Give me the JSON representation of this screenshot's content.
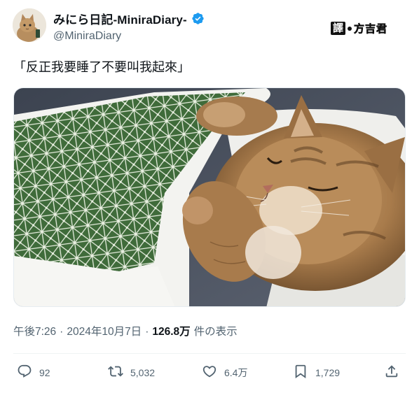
{
  "author": {
    "display_name": "みにら日記-MiniraDiary-",
    "handle": "@MiniraDiary",
    "verified_icon": "verified-badge-icon"
  },
  "watermark": {
    "box_text": "譯",
    "text": "方吉君"
  },
  "tweet": {
    "text": "「反正我要睡了不要叫我起來」"
  },
  "meta": {
    "time": "午後7:26",
    "separator1": "·",
    "date": "2024年10月7日",
    "separator2": "·",
    "views": "126.8万",
    "views_label": "件の表示"
  },
  "actions": {
    "replies": "92",
    "retweets": "5,032",
    "likes": "6.4万",
    "bookmarks": "1,729"
  },
  "colors": {
    "text_primary": "#0f1419",
    "text_secondary": "#536471",
    "verified_blue": "#1d9bf0",
    "quilt_green": "#3f6b3a"
  }
}
